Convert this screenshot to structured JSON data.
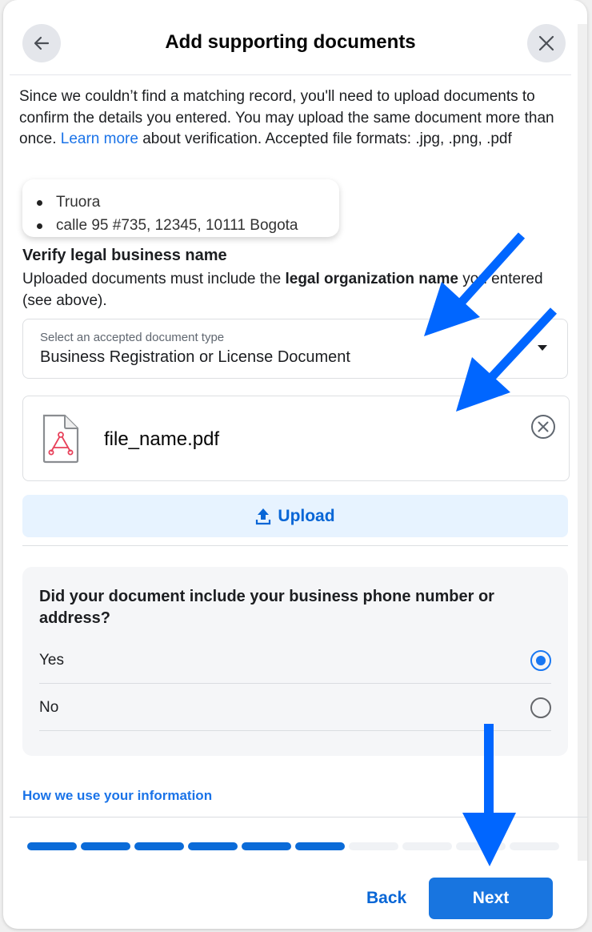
{
  "header": {
    "title": "Add supporting documents",
    "back_icon": "arrow-left-icon",
    "close_icon": "close-icon"
  },
  "intro": {
    "text_before": "Since we couldn’t find a matching record, you'll need to upload documents to confirm the details you entered. You may upload the same document more than once. ",
    "learn_more": "Learn more",
    "text_after": " about verification. Accepted file formats: .jpg, .png, .pdf"
  },
  "entered_details": [
    "Truora",
    "calle 95 #735, 12345, 10111 Bogota"
  ],
  "section": {
    "title": "Verify legal business name",
    "desc_before": "Uploaded documents must include the ",
    "desc_bold": "legal organization name",
    "desc_after": " you entered (see above)."
  },
  "document_select": {
    "label": "Select an accepted document type",
    "value": "Business Registration or License Document",
    "icon": "caret-down-icon"
  },
  "file": {
    "name": "file_name.pdf",
    "icon": "pdf-file-icon",
    "remove_icon": "remove-circle-icon"
  },
  "upload": {
    "label": "Upload",
    "icon": "upload-icon"
  },
  "question": {
    "text": "Did your document include your business phone number or address?",
    "options": [
      {
        "label": "Yes",
        "selected": true
      },
      {
        "label": "No",
        "selected": false
      }
    ]
  },
  "info_link": "How we use your information",
  "progress": {
    "completed_steps": 6,
    "total_steps": 10
  },
  "footer": {
    "back_label": "Back",
    "next_label": "Next"
  },
  "colors": {
    "primary": "#1875e0",
    "link": "#1a73e8",
    "upload_bg": "#e7f3ff",
    "annotation_arrow": "#0066ff"
  }
}
